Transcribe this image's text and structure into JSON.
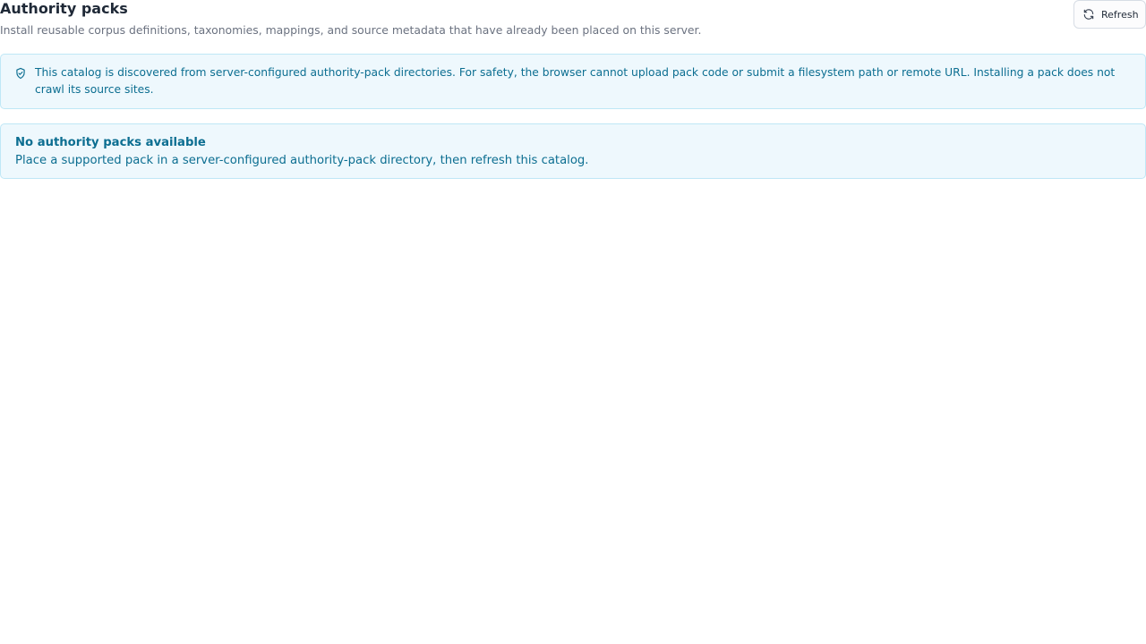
{
  "header": {
    "title": "Authority packs",
    "subtitle": "Install reusable corpus definitions, taxonomies, mappings, and source metadata that have already been placed on this server."
  },
  "toolbar": {
    "refresh_label": "Refresh",
    "refresh_icon": "refresh-icon"
  },
  "notice": {
    "icon": "shield-check-icon",
    "text": "This catalog is discovered from server-configured authority-pack directories. For safety, the browser cannot upload pack code or submit a filesystem path or remote URL. Installing a pack does not crawl its source sites."
  },
  "empty_state": {
    "title": "No authority packs available",
    "description": "Place a supported pack in a server-configured authority-pack directory, then refresh this catalog."
  },
  "colors": {
    "title": "#1f2937",
    "subtitle": "#6b7280",
    "info_text": "#0c6e91",
    "info_background": "#eef8fd",
    "info_border": "#bfe7f6"
  }
}
